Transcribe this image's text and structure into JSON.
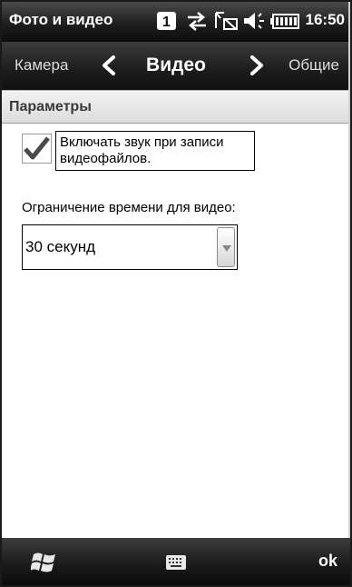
{
  "status_bar": {
    "title": "Фото и видео",
    "notification_count": "1",
    "time": "16:50",
    "icons": [
      "notification-badge-icon",
      "data-connection-icon",
      "signal-off-icon",
      "speaker-icon",
      "battery-icon"
    ]
  },
  "nav": {
    "prev_label": "Камера",
    "current_label": "Видео",
    "next_label": "Общие"
  },
  "section": {
    "title": "Параметры"
  },
  "record_sound": {
    "label": "Включать звук при записи видеофайлов.",
    "checked": true
  },
  "time_limit": {
    "label": "Ограничение времени для видео:",
    "value": "30 секунд"
  },
  "bottom_bar": {
    "ok_label": "ok",
    "icons": [
      "start-windows-icon",
      "keyboard-icon"
    ]
  },
  "colors": {
    "bar_dark": "#1c1c1c",
    "header_light": "#e6e6e6",
    "text": "#000000"
  }
}
